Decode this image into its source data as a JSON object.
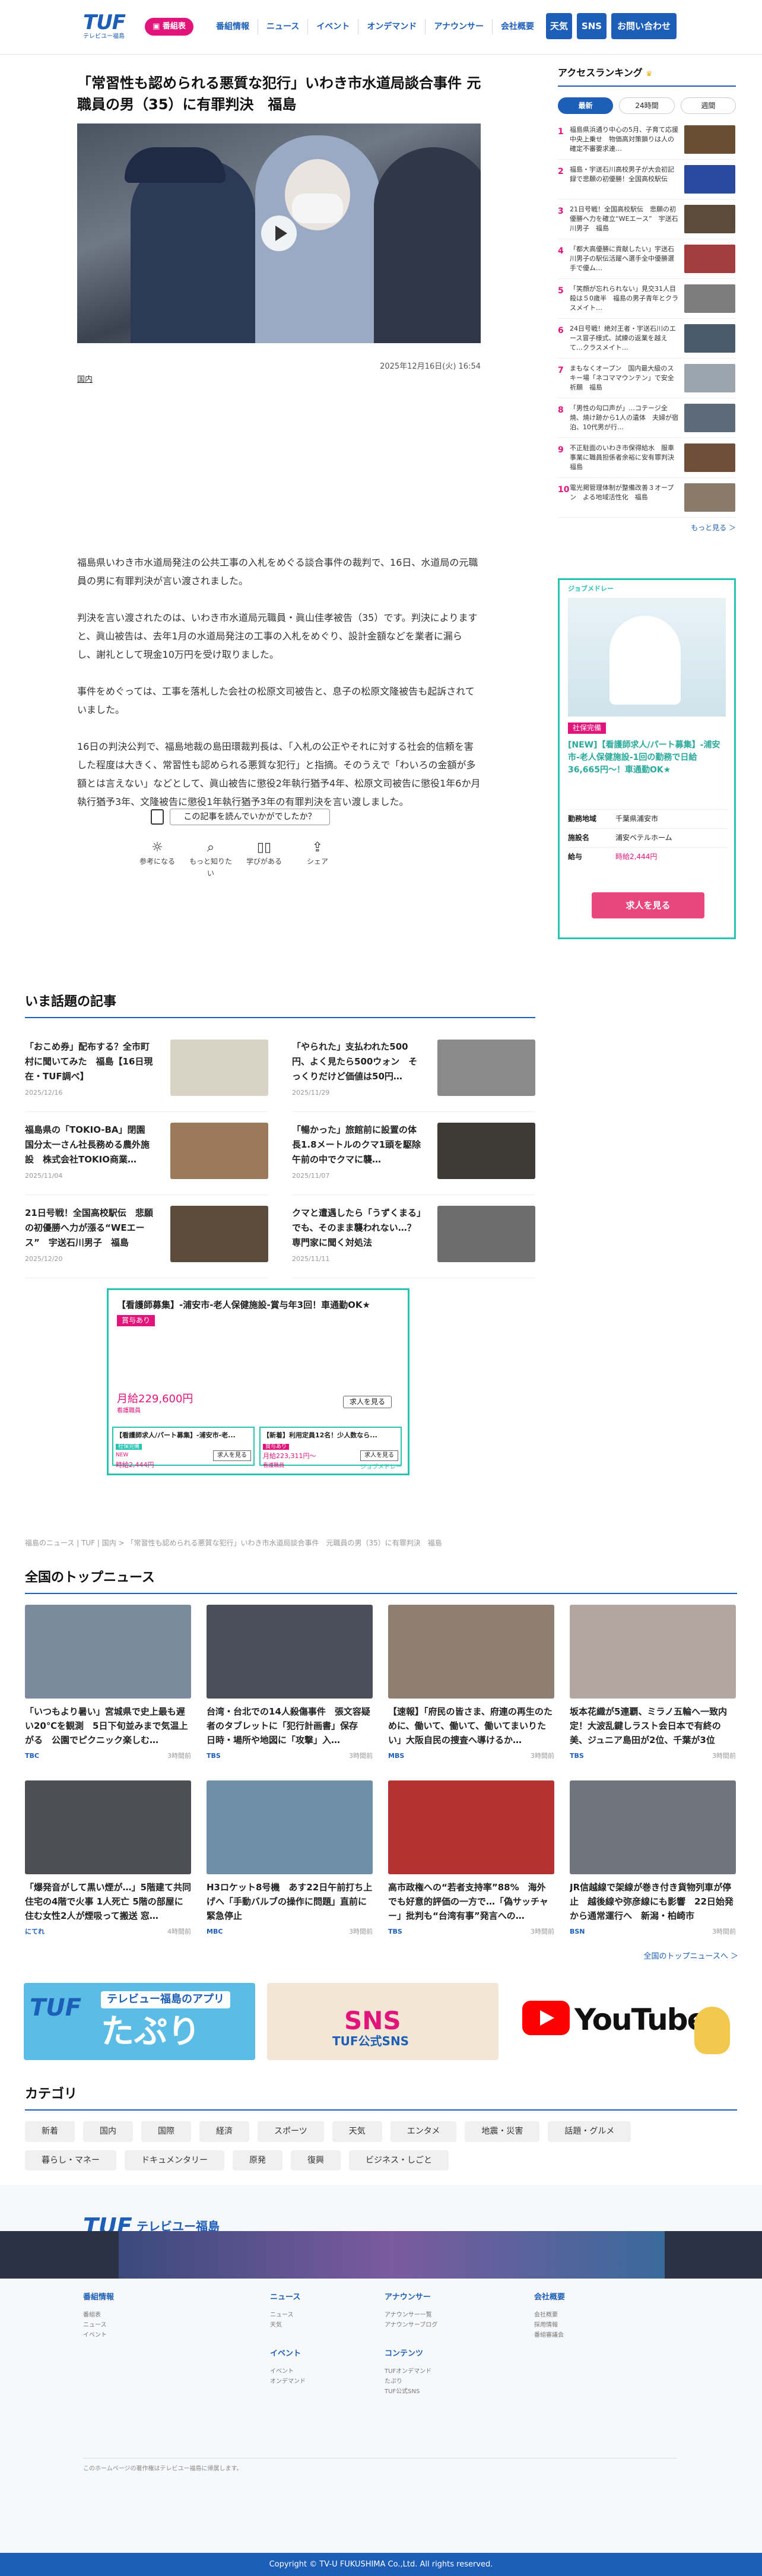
{
  "header": {
    "logo_text": "TUF",
    "logo_sub": "テレビユー福島",
    "schedule_btn": "番組表",
    "nav": [
      "番組情報",
      "ニュース",
      "イベント",
      "オンデマンド",
      "アナウンサー",
      "会社概要"
    ],
    "weather_btn": "天気",
    "sns_btn": "SNS",
    "contact_btn": "お問い合わせ"
  },
  "article": {
    "title": "「常習性も認められる悪質な犯行」いわき市水道局談合事件 元職員の男（35）に有罪判決　福島",
    "date": "2025年12月16日(火) 16:54",
    "category": "国内",
    "paragraphs": [
      "福島県いわき市水道局発注の公共工事の入札をめぐる談合事件の裁判で、16日、水道局の元職員の男に有罪判決が言い渡されました。",
      "判決を言い渡されたのは、いわき市水道局元職員・眞山佳孝被告（35）です。判決によりますと、眞山被告は、去年1月の水道局発注の工事の入札をめぐり、設計金額などを業者に漏らし、謝礼として現金10万円を受け取りました。",
      "事件をめぐっては、工事を落札した会社の松原文司被告と、息子の松原文隆被告も起訴されていました。",
      "16日の判決公判で、福島地裁の島田環裁判長は、「入札の公正やそれに対する社会的信頼を害した程度は大きく、常習性も認められる悪質な犯行」と指摘。そのうえで「わいろの金額が多額とは言えない」などとして、眞山被告に懲役2年執行猶予4年、松原文司被告に懲役1年6か月執行猶予3年、文隆被告に懲役1年執行猶予3年の有罪判決を言い渡しました。"
    ]
  },
  "feedback": {
    "question": "この記事を読んでいかがでしたか？",
    "options": [
      "参考になる",
      "もっと知りたい",
      "学びがある",
      "シェア"
    ]
  },
  "hot": {
    "heading": "いま話題の記事",
    "items": [
      {
        "title": "「おこめ券」配布する？全市町村に聞いてみた　福島【16日現在・TUF調べ】",
        "date": "2025/12/16",
        "color": "#d9d3c6"
      },
      {
        "title": "「やられた」支払われた500円、よく見たら500ウォン　そっくりだけど価値は50円…",
        "date": "2025/11/29",
        "color": "#8a8a8a"
      },
      {
        "title": "福島県の「TOKIO-BA」閉園　国分太一さん社長務める農外施設　株式会社TOKIO商業…",
        "date": "2025/11/04",
        "color": "#9a7a5a"
      },
      {
        "title": "「暢かった」旅館前に設置の体長1.8メートルのクマ1頭を駆除　午前の中でクマに襲…",
        "date": "2025/11/07",
        "color": "#3e3a35"
      },
      {
        "title": "21日号戦！全国高校駅伝　悲願の初優勝へ力が漲る“WEエース”　宇送石川男子　福島",
        "date": "2025/12/20",
        "color": "#5b4b3a"
      },
      {
        "title": "クマと遭遇したら「うずくまる」でも、そのまま襲われない…？専門家に聞く対処法",
        "date": "2025/11/11",
        "color": "#6d6d6d"
      }
    ]
  },
  "inline_ad": {
    "label": "【看護師募集】-浦安市-老人保健施設-賞与年3回！車通勤OK★",
    "badge": "賞与あり",
    "salary": "月給229,600円",
    "salary_note": "看護職員",
    "btn": "求人を見る",
    "sub1_title": "【看護師求人/パート募集】-浦安市-老...",
    "sub1_badge": "社保完備",
    "sub1_pay": "時給2,444円",
    "sub1_note": "NEW",
    "sub2_title": "【新着】利用定員12名！少人数なら...",
    "sub2_badge": "賞与あり",
    "sub2_pay": "月給223,311円～",
    "sub2_note": "看護職員",
    "brand": "ジョブメドレー"
  },
  "breadcrumb": "福島のニュース | TUF | 国内 > 「常習性も認められる悪質な犯行」いわき市水道局談合事件　元職員の男（35）に有罪判決　福島",
  "top_news": {
    "heading": "全国のトップニュース",
    "items": [
      {
        "title": "「いつもより暑い」宮城県で史上最も遅い20℃を観測　5日下旬並みまで気温上がる　公園でピクニック楽しむ…",
        "source": "TBC",
        "time": "3時間前",
        "color": "#7b8a9d"
      },
      {
        "title": "台湾・台北での14人殺傷事件　張文容疑者のタブレットに「犯行計画書」保存　日時・場所や地図に「攻撃」入…",
        "source": "TBS",
        "time": "3時間前",
        "color": "#4a4f5a"
      },
      {
        "title": "【速報】「府民の皆さま、府連の再生のために、働いて、働いて、働いてまいりたい」大阪自民の捜査へ導けるか…",
        "source": "MBS",
        "time": "3時間前",
        "color": "#8f7f73"
      },
      {
        "title": "坂本花織が5連覇、ミラノ五輪へ一致内定！大波乱鍵しラスト会日本で有終の美、ジュニア島田が2位、千葉が3位",
        "source": "TBS",
        "time": "3時間前",
        "color": "#b1a7a0"
      },
      {
        "title": "「爆発音がして黒い煙が…」5階建て共同住宅の4階で火事 1人死亡 5階の部屋に住む女性2人が煙吸って搬送 窓…",
        "source": "にてれ",
        "time": "4時間前",
        "color": "#4d4f54"
      },
      {
        "title": "H3ロケット8号機　あす22日午前打ち上げへ「手動バルブの操作に問題」直前に緊急停止",
        "source": "MBC",
        "time": "3時間前",
        "color": "#6f8fa8"
      },
      {
        "title": "高市政権への“若者支持率”88%　海外でも好意的評価の一方で…「偽サッチャー」批判も“台湾有事”発言への…",
        "source": "TBS",
        "time": "3時間前",
        "color": "#b43232"
      },
      {
        "title": "JR信越線で架線が巻き付き貨物列車が停止　越後線や弥彦線にも影響　22日始発から通常運行へ　新潟・柏崎市",
        "source": "BSN",
        "time": "3時間前",
        "color": "#70747c"
      }
    ],
    "more": "全国のトップニュースへ ＞"
  },
  "banners": {
    "app_big": "たぷり",
    "app_small": "テレビュー福島のアプリ",
    "sns_title": "TUF公式SNS",
    "yt": "YouTube"
  },
  "categories": {
    "heading": "カテゴリ",
    "items": [
      "新着",
      "国内",
      "国際",
      "経済",
      "スポーツ",
      "天気",
      "エンタメ",
      "地震・災害",
      "話題・グルメ",
      "暮らし・マネー",
      "ドキュメンタリー",
      "原発",
      "復興",
      "ビジネス・しごと"
    ]
  },
  "sidebar": {
    "ranking_title": "アクセスランキング",
    "tabs": [
      "最新",
      "24時間",
      "週間"
    ],
    "items": [
      {
        "n": "1",
        "title": "福島県浜通り中心の5月、子育て応援中央上乗せ　物価高対策鎖りは人の確定不審要求連…",
        "color": "#6a4e34"
      },
      {
        "n": "2",
        "title": "福島・宇送石川高校男子が大会初記録で悲願の初優勝！全国高校駅伝",
        "color": "#2a4aa0"
      },
      {
        "n": "3",
        "title": "21日号戦！全国高校駅伝　悲願の初優勝へ力を確立“WEエース”　宇送石川男子　福島",
        "color": "#5b4b3a"
      },
      {
        "n": "4",
        "title": "「都大高優勝に貢献したい」宇送石川男子の駅伝活躍へ選手全中優勝選手で優ム…",
        "color": "#a43d3d"
      },
      {
        "n": "5",
        "title": "「笑顔が忘れられない」見交31人目殺は５0歳半　福島の男子青年とクラスメイト…",
        "color": "#7d7d7d"
      },
      {
        "n": "6",
        "title": "24日号戦！絶対王者・宇送石川のエース冒子様式、試練の返業を越えて…クラスメイト…",
        "color": "#4a5a6a"
      },
      {
        "n": "7",
        "title": "まもなくオープン　国内最大級のスキー場「ネコママウンテン」で安全祈願　福島",
        "color": "#9aa5ad"
      },
      {
        "n": "8",
        "title": "「男性の勾口声が」…コテージ全焼、焼け跡から1人の遺体　夫婦が宿泊、10代男が行…",
        "color": "#5d6a78"
      },
      {
        "n": "9",
        "title": "不正駐面のいわき市保得給水　服車事業に職員担係者余裕に安有罪判決　福島",
        "color": "#6f4f3a"
      },
      {
        "n": "10",
        "title": "電光掲管理体制が整備改善３オープン　よる地域活性化　福島",
        "color": "#8a7a6a"
      }
    ],
    "more": "もっと見る ＞",
    "ad": {
      "brand": "ジョブメドレー",
      "badge": "社保完備",
      "title": "[NEW]【看護師求人/パート募集】-浦安市-老人保健施設-1回の勤務で日給36,665円～！車通勤OK★",
      "loc_label": "勤務地域",
      "loc": "千葉県浦安市",
      "fac_label": "施設名",
      "fac": "浦安ベテルホーム",
      "pay_label": "給与",
      "pay": "時給2,444円",
      "btn": "求人を見る"
    }
  },
  "footer": {
    "logo": "TUF",
    "logo_name": "テレビユー福島",
    "cols": [
      {
        "h": "番組情報",
        "items": [
          "番組表",
          "ニュース",
          "イベント"
        ]
      },
      {
        "h": "ニュース",
        "items": [
          "ニュース",
          "天気"
        ]
      },
      {
        "h": "アナウンサー",
        "items": [
          "アナウンサー一覧",
          "アナウンサーブログ"
        ]
      },
      {
        "h": "会社概要",
        "items": [
          "会社概要",
          "採用情報",
          "番組審議会"
        ]
      }
    ],
    "col2b": {
      "h": "イベント",
      "items": [
        "イベント",
        "オンデマンド"
      ]
    },
    "col3b": {
      "h": "コンテンツ",
      "items": [
        "TUFオンデマンド",
        "たぷり",
        "TUF公式SNS"
      ]
    },
    "note": "このホームページの著作権はテレビユー福島に帰属します。",
    "copyright": "Copyright © TV-U FUKUSHIMA Co.,Ltd. All rights reserved."
  }
}
